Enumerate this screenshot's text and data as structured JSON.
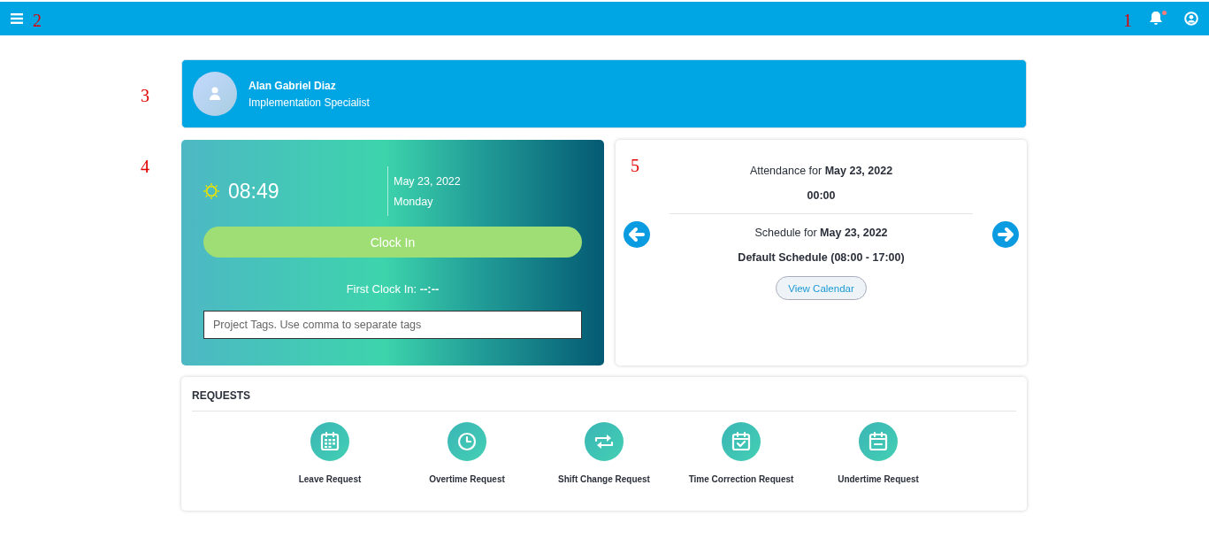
{
  "top_bar": {
    "notifications": {
      "unread": true
    }
  },
  "profile": {
    "name": "Alan Gabriel Diaz",
    "role": "Implementation Specialist"
  },
  "clock": {
    "time": "08:49",
    "date": "May 23, 2022",
    "day": "Monday",
    "button": "Clock In",
    "first_clock_in": "First Clock In: **--:--**",
    "tags_field": {
      "placeholder": "Project Tags. Use comma to separate tags"
    }
  },
  "attendance": {
    "heading": "Attendance for **May 23, 2022**",
    "total": "00:00",
    "schedule_heading": "Schedule for **May 23, 2022**",
    "schedule": "Default Schedule (08:00 - 17:00)",
    "button": "View Calendar"
  },
  "requests": {
    "title": "REQUESTS",
    "items": [
      {
        "label": "Leave Request"
      },
      {
        "label": "Overtime Request"
      },
      {
        "label": "Shift Change Request"
      },
      {
        "label": "Time Correction Request"
      },
      {
        "label": "Undertime Request"
      }
    ]
  },
  "annotations": [
    "2",
    "1",
    "3",
    "4",
    "5"
  ]
}
